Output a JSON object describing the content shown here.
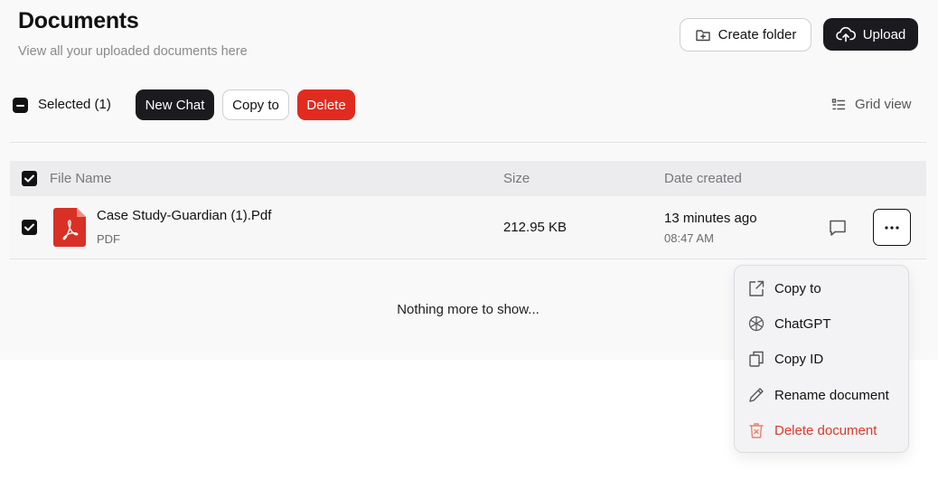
{
  "header": {
    "title": "Documents",
    "subtitle": "View all your uploaded documents here",
    "create_folder_label": "Create folder",
    "upload_label": "Upload"
  },
  "toolbar": {
    "selected_label": "Selected (1)",
    "new_chat_label": "New Chat",
    "copy_to_label": "Copy to",
    "delete_label": "Delete",
    "view_toggle_label": "Grid view"
  },
  "table": {
    "columns": [
      "File Name",
      "Size",
      "Date created"
    ],
    "rows": [
      {
        "checked": true,
        "name": "Case Study-Guardian (1).Pdf",
        "type": "PDF",
        "size": "212.95 KB",
        "date": "13 minutes ago",
        "time": "08:47 AM",
        "icon": "pdf-icon"
      }
    ],
    "empty_message": "Nothing more to show..."
  },
  "context_menu": {
    "items": [
      {
        "label": "Copy to",
        "icon": "share-icon"
      },
      {
        "label": "ChatGPT",
        "icon": "chatgpt-icon"
      },
      {
        "label": "Copy ID",
        "icon": "copy-icon"
      },
      {
        "label": "Rename document",
        "icon": "pencil-icon"
      },
      {
        "label": "Delete document",
        "icon": "trash-icon"
      }
    ]
  },
  "colors": {
    "accent_dark": "#1a1a1f",
    "danger": "#e02b20",
    "pdf_red": "#d93025"
  }
}
